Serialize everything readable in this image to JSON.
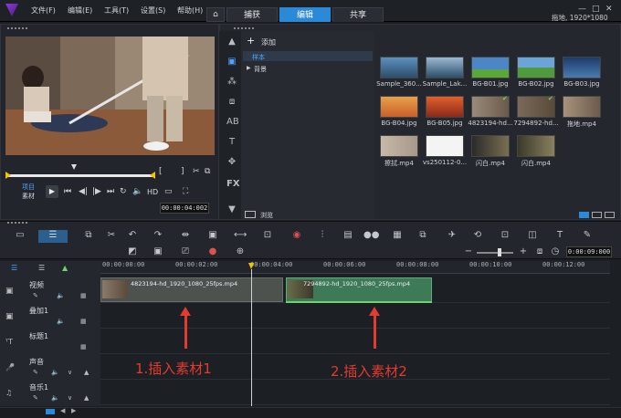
{
  "menu": {
    "file": "文件(F)",
    "edit": "编辑(E)",
    "tools": "工具(T)",
    "settings": "设置(S)",
    "help": "帮助(H)"
  },
  "tabs": [
    "捕获",
    "编辑",
    "共享"
  ],
  "active_tab": "编辑",
  "project_info": "拖地, 1920*1080",
  "preview": {
    "project_label": "项目",
    "clip_label": "素材",
    "hd_label": "HD",
    "timecode": "00:00:04:002"
  },
  "library": {
    "add_label": "添加",
    "folders": [
      "样本",
      "背景"
    ],
    "browse_label": "浏览",
    "thumbnails": [
      {
        "label": "Sample_360...",
        "color": "#3d6e96"
      },
      {
        "label": "Sample_Lak...",
        "color": "#2f5f86"
      },
      {
        "label": "BG-B01.jpg",
        "color": "#4a86c8"
      },
      {
        "label": "BG-B02.jpg",
        "color": "#4f9a3c"
      },
      {
        "label": "BG-B03.jpg",
        "color": "#335a8c"
      },
      {
        "label": "BG-B04.jpg",
        "color": "#e0803a"
      },
      {
        "label": "BG-B05.jpg",
        "color": "#c8452a"
      },
      {
        "label": "4823194-hd...",
        "color": "#8a7a6a"
      },
      {
        "label": "7294892-hd...",
        "color": "#6c5c4c"
      },
      {
        "label": "拖地.mp4",
        "color": "#8c7a64"
      },
      {
        "label": "擦拭.mp4",
        "color": "#b8a89a"
      },
      {
        "label": "vs250112-0...",
        "color": "#f2f2f2"
      },
      {
        "label": "闪白.mp4",
        "color": "#3a3a3a"
      },
      {
        "label": "闪白.mp4",
        "color": "#4a4a3a"
      }
    ]
  },
  "timeline": {
    "ruler": [
      "00:00:00:00",
      "00:00:02:00",
      "00:00:04:00",
      "00:00:06:00",
      "00:00:08:00",
      "00:00:10:00",
      "00:00:12:00"
    ],
    "zoom_timecode": "0:00:09:000",
    "tracks": [
      "视频",
      "叠加1",
      "标题1",
      "声音",
      "音乐1"
    ],
    "clips": [
      {
        "label": "4823194-hd_1920_1080_25fps.mp4",
        "color": "#4e524f"
      },
      {
        "label": "7294892-hd_1920_1080_25fps.mp4",
        "color": "#3d7a55"
      }
    ]
  },
  "annotations": [
    "1.插入素材1",
    "2.插入素材2"
  ]
}
